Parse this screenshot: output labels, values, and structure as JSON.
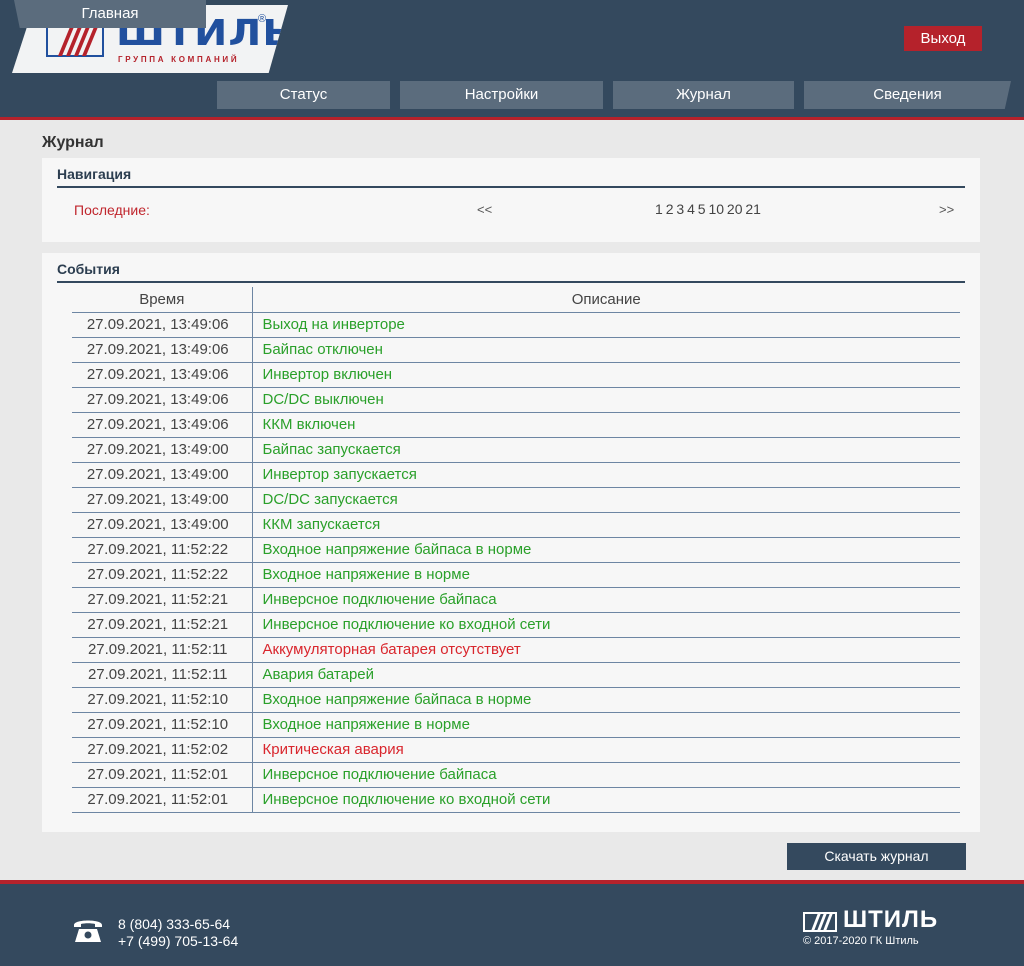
{
  "header": {
    "logo_text": "ШТИЛЬ",
    "logo_sub": "ГРУППА КОМПАНИЙ",
    "logo_reg": "®",
    "exit_label": "Выход"
  },
  "nav": {
    "items": [
      "Главная",
      "Статус",
      "Настройки",
      "Журнал",
      "Сведения"
    ]
  },
  "page": {
    "title": "Журнал"
  },
  "navigation": {
    "title": "Навигация",
    "latest_label": "Последние:",
    "prev_label": "<<",
    "next_label": ">>",
    "pages": [
      "1",
      "2",
      "3",
      "4",
      "5",
      "10",
      "20",
      "21"
    ]
  },
  "events": {
    "title": "События",
    "columns": [
      "Время",
      "Описание"
    ],
    "rows": [
      {
        "time": "27.09.2021, 13:49:06",
        "desc": "Выход на инверторе",
        "level": "ok"
      },
      {
        "time": "27.09.2021, 13:49:06",
        "desc": "Байпас отключен",
        "level": "ok"
      },
      {
        "time": "27.09.2021, 13:49:06",
        "desc": "Инвертор включен",
        "level": "ok"
      },
      {
        "time": "27.09.2021, 13:49:06",
        "desc": "DC/DC выключен",
        "level": "ok"
      },
      {
        "time": "27.09.2021, 13:49:06",
        "desc": "ККМ включен",
        "level": "ok"
      },
      {
        "time": "27.09.2021, 13:49:00",
        "desc": "Байпас запускается",
        "level": "ok"
      },
      {
        "time": "27.09.2021, 13:49:00",
        "desc": "Инвертор запускается",
        "level": "ok"
      },
      {
        "time": "27.09.2021, 13:49:00",
        "desc": "DC/DC запускается",
        "level": "ok"
      },
      {
        "time": "27.09.2021, 13:49:00",
        "desc": "ККМ запускается",
        "level": "ok"
      },
      {
        "time": "27.09.2021, 11:52:22",
        "desc": "Входное напряжение байпаса в норме",
        "level": "ok"
      },
      {
        "time": "27.09.2021, 11:52:22",
        "desc": "Входное напряжение в норме",
        "level": "ok"
      },
      {
        "time": "27.09.2021, 11:52:21",
        "desc": "Инверсное подключение байпаса",
        "level": "ok"
      },
      {
        "time": "27.09.2021, 11:52:21",
        "desc": "Инверсное подключение ко входной сети",
        "level": "ok"
      },
      {
        "time": "27.09.2021, 11:52:11",
        "desc": "Аккумуляторная батарея отсутствует",
        "level": "err"
      },
      {
        "time": "27.09.2021, 11:52:11",
        "desc": "Авария батарей",
        "level": "ok"
      },
      {
        "time": "27.09.2021, 11:52:10",
        "desc": "Входное напряжение байпаса в норме",
        "level": "ok"
      },
      {
        "time": "27.09.2021, 11:52:10",
        "desc": "Входное напряжение в норме",
        "level": "ok"
      },
      {
        "time": "27.09.2021, 11:52:02",
        "desc": "Критическая авария",
        "level": "err"
      },
      {
        "time": "27.09.2021, 11:52:01",
        "desc": "Инверсное подключение байпаса",
        "level": "ok"
      },
      {
        "time": "27.09.2021, 11:52:01",
        "desc": "Инверсное подключение ко входной сети",
        "level": "ok"
      }
    ]
  },
  "download_label": "Скачать журнал",
  "footer": {
    "phone1": "8  (804) 333-65-64",
    "phone2": "+7 (499) 705-13-64",
    "logo_text": "ШТИЛЬ",
    "copyright": "© 2017-2020 ГК Штиль"
  },
  "colors": {
    "header_bg": "#34495e",
    "accent_red": "#b5222b",
    "ok_green": "#2aa02a",
    "error_red": "#d9262d",
    "logo_blue": "#21509e"
  },
  "icons": {
    "phone": "phone-icon",
    "logo": "shtil-logo-icon"
  }
}
